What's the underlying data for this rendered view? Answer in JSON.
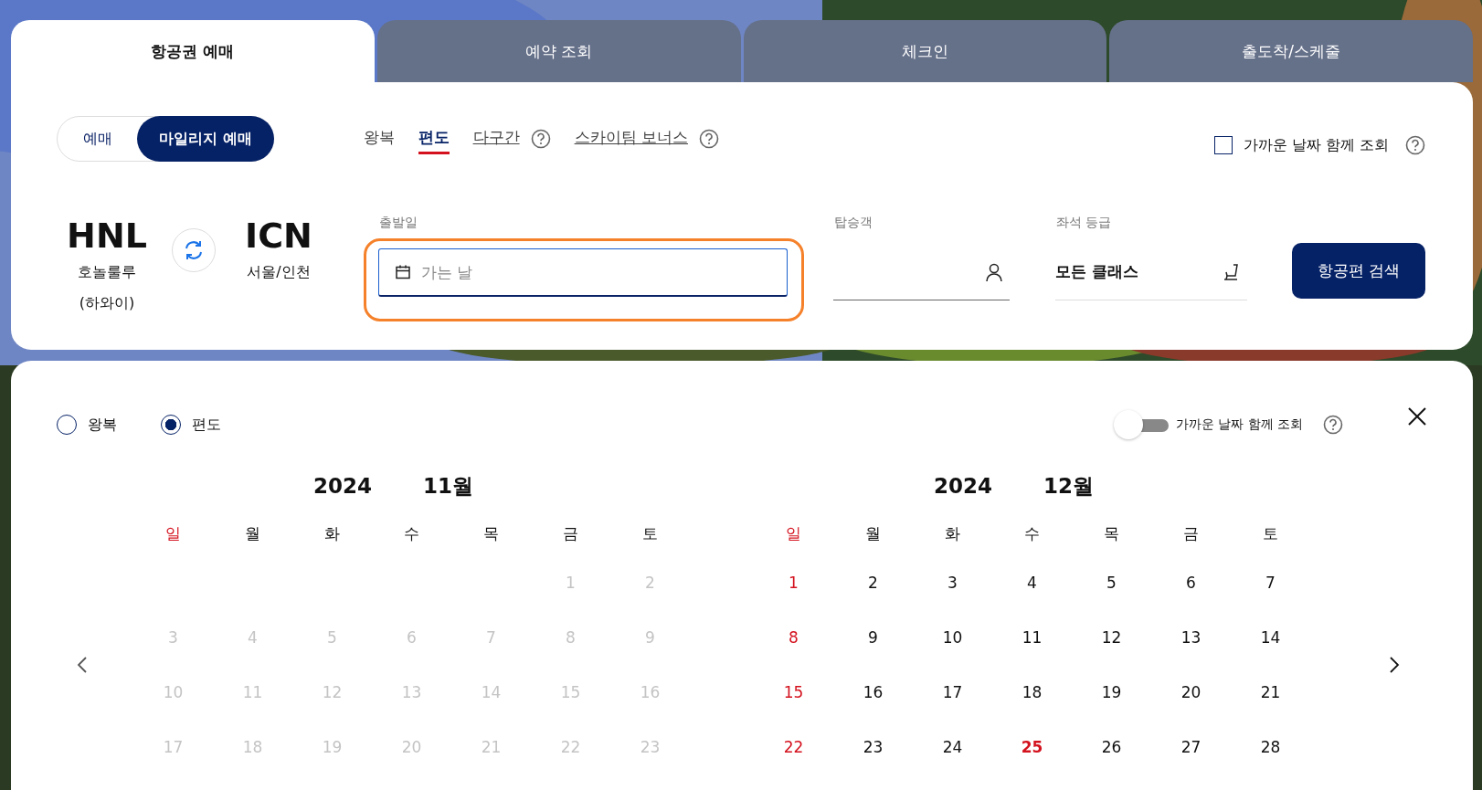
{
  "tabs": [
    {
      "label": "항공권 예매",
      "selected": true
    },
    {
      "label": "예약 조회",
      "selected": false
    },
    {
      "label": "체크인",
      "selected": false
    },
    {
      "label": "출도착/스케줄",
      "selected": false
    }
  ],
  "booking_type": [
    {
      "label": "예매",
      "selected": false
    },
    {
      "label": "마일리지 예매",
      "selected": true
    }
  ],
  "trip_types": [
    {
      "label": "왕복",
      "selected": false,
      "kind": "plain"
    },
    {
      "label": "편도",
      "selected": true,
      "kind": "plain"
    },
    {
      "label": "다구간",
      "selected": false,
      "kind": "link",
      "help": true
    },
    {
      "label": "스카이팀 보너스",
      "selected": false,
      "kind": "link",
      "help": true
    }
  ],
  "nearby_dates": {
    "label": "가까운 날짜 함께 조회",
    "checked": false
  },
  "route": {
    "from": {
      "code": "HNL",
      "name": "호놀룰루 (하와이)"
    },
    "to": {
      "code": "ICN",
      "name": "서울/인천"
    }
  },
  "departure_date": {
    "label": "출발일",
    "placeholder": "가는 날",
    "highlighted": true
  },
  "passengers": {
    "label": "탑승객"
  },
  "seat_class": {
    "label": "좌석 등급",
    "value": "모든 클래스"
  },
  "search_button": "항공편 검색",
  "calendar": {
    "trip_radios": [
      {
        "label": "왕복",
        "selected": false
      },
      {
        "label": "편도",
        "selected": true
      }
    ],
    "nearby_toggle": {
      "label": "가까운 날짜 함께 조회",
      "on": false
    },
    "months": [
      {
        "year": "2024",
        "month": "11월",
        "past": true,
        "weekdays": [
          "일",
          "월",
          "화",
          "수",
          "목",
          "금",
          "토"
        ],
        "weeks": [
          [
            {
              "day": "1"
            },
            {
              "day": "2"
            }
          ],
          [
            {
              "day": "3"
            },
            {
              "day": "4"
            },
            {
              "day": "5"
            },
            {
              "day": "6"
            },
            {
              "day": "7"
            },
            {
              "day": "8"
            },
            {
              "day": "9"
            }
          ],
          [
            {
              "day": "10"
            },
            {
              "day": "11"
            },
            {
              "day": "12"
            },
            {
              "day": "13"
            },
            {
              "day": "14"
            },
            {
              "day": "15"
            },
            {
              "day": "16"
            }
          ],
          [
            {
              "day": "17"
            },
            {
              "day": "18"
            },
            {
              "day": "19"
            },
            {
              "day": "20"
            },
            {
              "day": "21"
            },
            {
              "day": "22"
            },
            {
              "day": "23"
            }
          ]
        ]
      },
      {
        "year": "2024",
        "month": "12월",
        "past": false,
        "weekdays": [
          "일",
          "월",
          "화",
          "수",
          "목",
          "금",
          "토"
        ],
        "weeks": [
          [
            {
              "day": "1"
            },
            {
              "day": "2"
            },
            {
              "day": "3"
            },
            {
              "day": "4"
            },
            {
              "day": "5"
            },
            {
              "day": "6"
            },
            {
              "day": "7"
            }
          ],
          [
            {
              "day": "8"
            },
            {
              "day": "9"
            },
            {
              "day": "10"
            },
            {
              "day": "11"
            },
            {
              "day": "12"
            },
            {
              "day": "13"
            },
            {
              "day": "14"
            }
          ],
          [
            {
              "day": "15"
            },
            {
              "day": "16"
            },
            {
              "day": "17"
            },
            {
              "day": "18"
            },
            {
              "day": "19"
            },
            {
              "day": "20"
            },
            {
              "day": "21"
            }
          ],
          [
            {
              "day": "22"
            },
            {
              "day": "23"
            },
            {
              "day": "24"
            },
            {
              "day": "25",
              "holiday": true
            },
            {
              "day": "26"
            },
            {
              "day": "27"
            },
            {
              "day": "28"
            }
          ]
        ]
      }
    ]
  }
}
